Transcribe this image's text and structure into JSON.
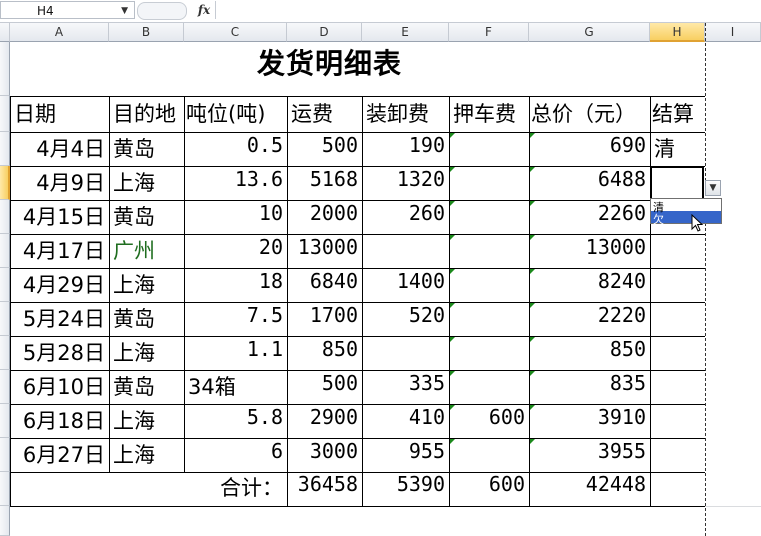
{
  "formula_bar": {
    "name_box": "H4",
    "fx_label": "fx",
    "formula": ""
  },
  "columns": [
    "A",
    "B",
    "C",
    "D",
    "E",
    "F",
    "G",
    "H",
    "I"
  ],
  "selected_column": "H",
  "sheet": {
    "title": "发货明细表",
    "headers": [
      "日期",
      "目的地",
      "吨位(吨)",
      "运费",
      "装卸费",
      "押车费",
      "总价（元）",
      "结算"
    ],
    "rows": [
      {
        "date": "4月4日",
        "dest": "黄岛",
        "tons": "0.5",
        "freight": "500",
        "handling": "190",
        "escort": "",
        "total": "690",
        "settle": "清"
      },
      {
        "date": "4月9日",
        "dest": "上海",
        "tons": "13.6",
        "freight": "5168",
        "handling": "1320",
        "escort": "",
        "total": "6488",
        "settle": ""
      },
      {
        "date": "4月15日",
        "dest": "黄岛",
        "tons": "10",
        "freight": "2000",
        "handling": "260",
        "escort": "",
        "total": "2260",
        "settle": ""
      },
      {
        "date": "4月17日",
        "dest": "广州",
        "tons": "20",
        "freight": "13000",
        "handling": "",
        "escort": "",
        "total": "13000",
        "settle": ""
      },
      {
        "date": "4月29日",
        "dest": "上海",
        "tons": "18",
        "freight": "6840",
        "handling": "1400",
        "escort": "",
        "total": "8240",
        "settle": ""
      },
      {
        "date": "5月24日",
        "dest": "黄岛",
        "tons": "7.5",
        "freight": "1700",
        "handling": "520",
        "escort": "",
        "total": "2220",
        "settle": ""
      },
      {
        "date": "5月28日",
        "dest": "上海",
        "tons": "1.1",
        "freight": "850",
        "handling": "",
        "escort": "",
        "total": "850",
        "settle": ""
      },
      {
        "date": "6月10日",
        "dest": "黄岛",
        "tons": "34箱",
        "freight": "500",
        "handling": "335",
        "escort": "",
        "total": "835",
        "settle": ""
      },
      {
        "date": "6月18日",
        "dest": "上海",
        "tons": "5.8",
        "freight": "2900",
        "handling": "410",
        "escort": "600",
        "total": "3910",
        "settle": ""
      },
      {
        "date": "6月27日",
        "dest": "上海",
        "tons": "6",
        "freight": "3000",
        "handling": "955",
        "escort": "",
        "total": "3955",
        "settle": ""
      }
    ],
    "summary": {
      "label": "合计：",
      "freight": "36458",
      "handling": "5390",
      "escort": "600",
      "total": "42448"
    }
  },
  "dropdown": {
    "options": [
      "清",
      "欠"
    ],
    "highlighted_index": 1
  },
  "colors": {
    "selected_header": "#f8cf62",
    "highlight": "#3565c9",
    "error_triangle": "#1c8a1c"
  }
}
